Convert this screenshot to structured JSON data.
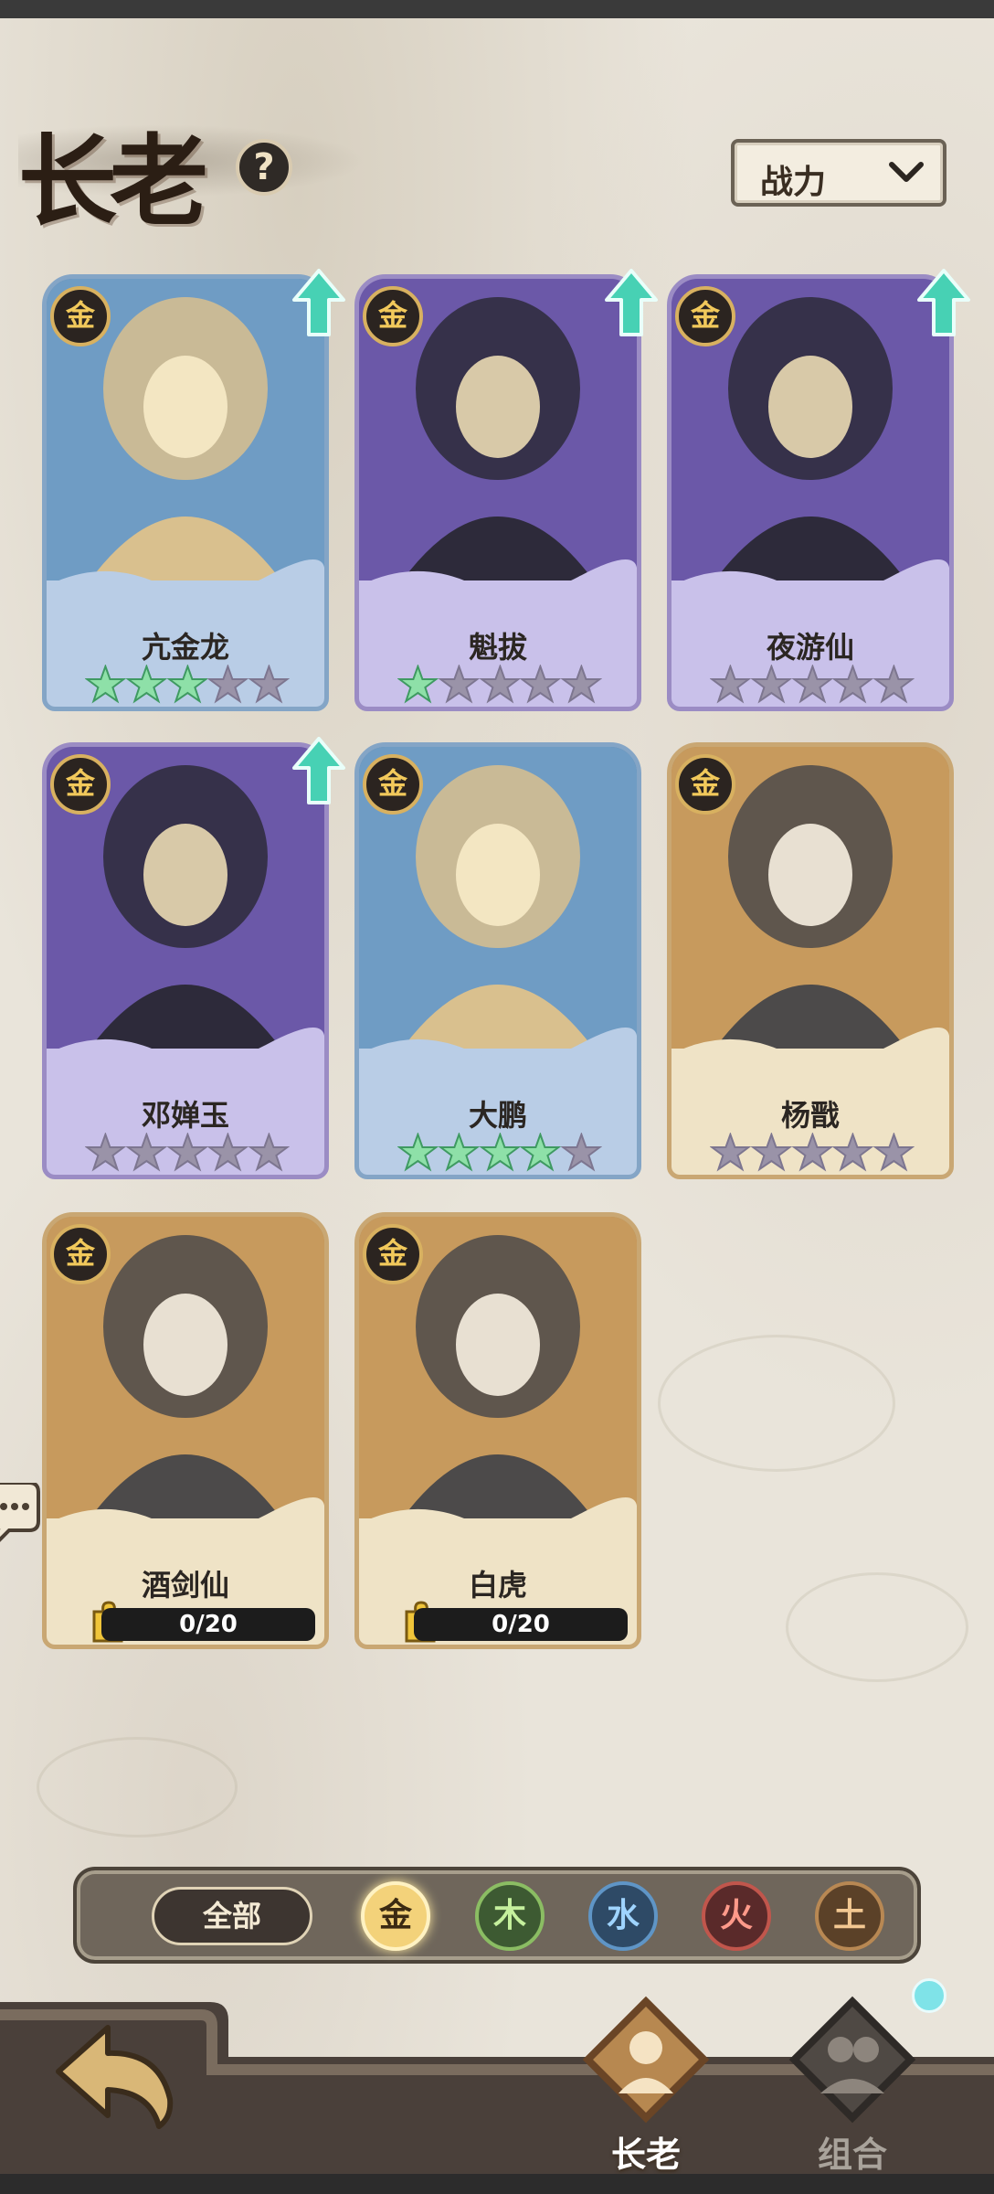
{
  "header": {
    "title": "长老",
    "help_icon": "?",
    "sort": {
      "selected": "战力"
    }
  },
  "cards": [
    {
      "name": "亢金龙",
      "element": "金",
      "stars_lit": 3,
      "stars_total": 5,
      "can_upgrade": true,
      "frame": "blue"
    },
    {
      "name": "魁拔",
      "element": "金",
      "stars_lit": 1,
      "stars_total": 5,
      "can_upgrade": true,
      "frame": "purple"
    },
    {
      "name": "夜游仙",
      "element": "金",
      "stars_lit": 0,
      "stars_total": 5,
      "can_upgrade": true,
      "frame": "purple"
    },
    {
      "name": "邓婵玉",
      "element": "金",
      "stars_lit": 0,
      "stars_total": 5,
      "can_upgrade": true,
      "frame": "purple"
    },
    {
      "name": "大鹏",
      "element": "金",
      "stars_lit": 4,
      "stars_total": 5,
      "can_upgrade": false,
      "frame": "blue"
    },
    {
      "name": "杨戬",
      "element": "金",
      "stars_lit": 0,
      "stars_total": 5,
      "can_upgrade": false,
      "frame": "gold"
    },
    {
      "name": "酒剑仙",
      "element": "金",
      "fragments": "0/20",
      "frame": "gold"
    },
    {
      "name": "白虎",
      "element": "金",
      "fragments": "0/20",
      "frame": "gold"
    }
  ],
  "filters": {
    "all": "全部",
    "elements": [
      "金",
      "木",
      "水",
      "火",
      "土"
    ],
    "selected": "金"
  },
  "nav": {
    "tabs": [
      {
        "label": "长老",
        "active": true
      },
      {
        "label": "组合",
        "active": false
      }
    ]
  }
}
